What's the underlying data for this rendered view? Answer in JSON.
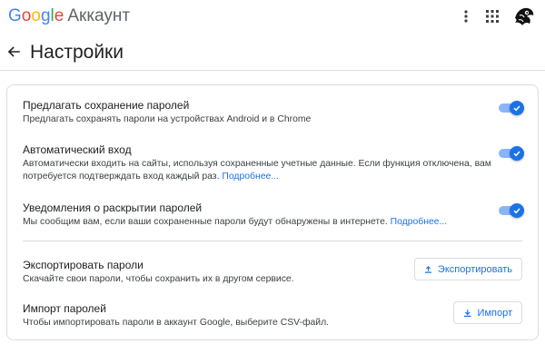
{
  "app": {
    "logo_letters": [
      "G",
      "o",
      "o",
      "g",
      "l",
      "e"
    ],
    "product_name": "Аккаунт"
  },
  "topbar": {
    "icons": [
      "more-vert-icon",
      "apps-grid-icon",
      "avatar"
    ]
  },
  "header": {
    "title": "Настройки",
    "back_icon": "arrow-back-icon"
  },
  "settings": [
    {
      "title": "Предлагать сохранение паролей",
      "description": "Предлагать сохранять пароли на устройствах Android и в Chrome",
      "enabled": true
    },
    {
      "title": "Автоматический вход",
      "description_line1": "Автоматически входить на сайты, используя сохраненные учетные данные. Если функция отключена, вам",
      "description_line2": "потребуется подтверждать вход каждый раз.",
      "link": "Подробнее...",
      "enabled": true
    },
    {
      "title": "Уведомления о раскрытии паролей",
      "description": "Мы сообщим вам, если ваши сохраненные пароли будут обнаружены в интернете.",
      "link": "Подробнее...",
      "enabled": true
    }
  ],
  "export": {
    "title": "Экспортировать пароли",
    "description": "Скачайте свои пароли, чтобы сохранить их в другом сервисе.",
    "button_label": "Экспортировать",
    "button_icon": "upload-icon"
  },
  "import": {
    "title": "Импорт паролей",
    "description": "Чтобы импортировать пароли в аккаунт Google, выберите CSV-файл.",
    "button_label": "Импорт",
    "button_icon": "download-icon"
  },
  "colors": {
    "accent": "#1a73e8",
    "toggle_track": "#8ab4f8",
    "divider": "#dadce0"
  }
}
